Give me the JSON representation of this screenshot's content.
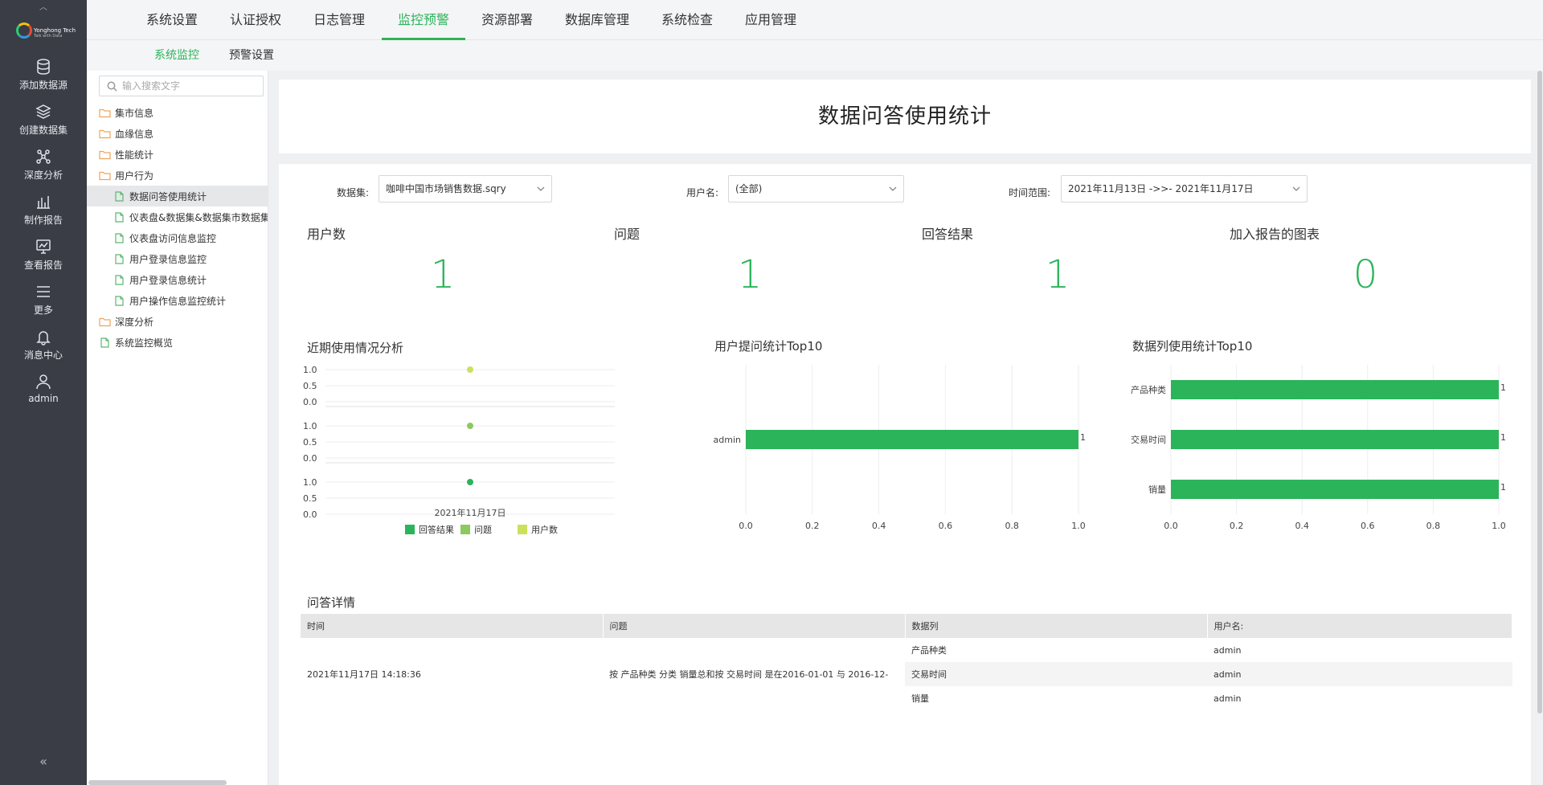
{
  "rail": {
    "brand": "Yonghong Tech",
    "tagline": "Talk with Data",
    "items": [
      {
        "label": "添加数据源",
        "icon": "database-icon"
      },
      {
        "label": "创建数据集",
        "icon": "layers-icon"
      },
      {
        "label": "深度分析",
        "icon": "network-icon"
      },
      {
        "label": "制作报告",
        "icon": "bar-chart-icon"
      },
      {
        "label": "查看报告",
        "icon": "monitor-chart-icon"
      },
      {
        "label": "更多",
        "icon": "menu-icon"
      },
      {
        "label": "消息中心",
        "icon": "bell-icon"
      },
      {
        "label": "admin",
        "icon": "user-icon"
      }
    ],
    "collapse_glyph": "«"
  },
  "topnav": {
    "items": [
      "系统设置",
      "认证授权",
      "日志管理",
      "监控预警",
      "资源部署",
      "数据库管理",
      "系统检查",
      "应用管理"
    ],
    "active": "监控预警"
  },
  "subnav": {
    "items": [
      "系统监控",
      "预警设置"
    ],
    "active": "系统监控"
  },
  "tree": {
    "search_placeholder": "输入搜索文字",
    "nodes": [
      {
        "label": "集市信息",
        "type": "folder",
        "level": 0
      },
      {
        "label": "血缘信息",
        "type": "folder",
        "level": 0
      },
      {
        "label": "性能统计",
        "type": "folder",
        "level": 0
      },
      {
        "label": "用户行为",
        "type": "folder-open",
        "level": 0
      },
      {
        "label": "数据问答使用统计",
        "type": "file",
        "level": 1,
        "selected": true
      },
      {
        "label": "仪表盘&数据集&数据集市数据集",
        "type": "file",
        "level": 1
      },
      {
        "label": "仪表盘访问信息监控",
        "type": "file",
        "level": 1
      },
      {
        "label": "用户登录信息监控",
        "type": "file",
        "level": 1
      },
      {
        "label": "用户登录信息统计",
        "type": "file",
        "level": 1
      },
      {
        "label": "用户操作信息监控统计",
        "type": "file",
        "level": 1
      },
      {
        "label": "深度分析",
        "type": "folder",
        "level": 0
      },
      {
        "label": "系统监控概览",
        "type": "file",
        "level": 0
      }
    ]
  },
  "page": {
    "title": "数据问答使用统计"
  },
  "filters": {
    "dataset_label": "数据集:",
    "dataset_value": "咖啡中国市场销售数据.sqry",
    "user_label": "用户名:",
    "user_value": "(全部)",
    "time_label": "时间范围:",
    "time_value": "2021年11月13日 ->>- 2021年11月17日"
  },
  "kpis": [
    {
      "label": "用户数",
      "value": "1"
    },
    {
      "label": "问题",
      "value": "1"
    },
    {
      "label": "回答结果",
      "value": "1"
    },
    {
      "label": "加入报告的图表",
      "value": "0"
    }
  ],
  "colors": {
    "accent": "#2bb45a",
    "series_answer": "#2bb45a",
    "series_question": "#8cc95f",
    "series_users": "#cde05b"
  },
  "chart_data": [
    {
      "type": "scatter",
      "title": "近期使用情况分析",
      "categories": [
        "2021年11月17日"
      ],
      "ylim": [
        0,
        1
      ],
      "yticks": [
        "1.0",
        "0.5",
        "0.0"
      ],
      "series": [
        {
          "name": "用户数",
          "values": [
            1
          ],
          "color": "#cde05b"
        },
        {
          "name": "问题",
          "values": [
            1
          ],
          "color": "#8cc95f"
        },
        {
          "name": "回答结果",
          "values": [
            1
          ],
          "color": "#2bb45a"
        }
      ],
      "legend": [
        "回答结果",
        "问题",
        "用户数"
      ],
      "legend_position": "bottom"
    },
    {
      "type": "bar",
      "orientation": "horizontal",
      "title": "用户提问统计Top10",
      "categories": [
        "admin"
      ],
      "values": [
        1
      ],
      "xlim": [
        0,
        1
      ],
      "xticks": [
        "0.0",
        "0.2",
        "0.4",
        "0.6",
        "0.8",
        "1.0"
      ]
    },
    {
      "type": "bar",
      "orientation": "horizontal",
      "title": "数据列使用统计Top10",
      "categories": [
        "产品种类",
        "交易时间",
        "销量"
      ],
      "values": [
        1,
        1,
        1
      ],
      "xlim": [
        0,
        1
      ],
      "xticks": [
        "0.0",
        "0.2",
        "0.4",
        "0.6",
        "0.8",
        "1.0"
      ]
    }
  ],
  "qa_detail": {
    "title": "问答详情",
    "columns": [
      "时间",
      "问题",
      "数据列",
      "用户名:"
    ],
    "time": "2021年11月17日 14:18:36",
    "question": "按 产品种类 分类 销量总和按 交易时间 是在2016-01-01 与 2016-12-",
    "rows": [
      {
        "column": "产品种类",
        "user": "admin"
      },
      {
        "column": "交易时间",
        "user": "admin"
      },
      {
        "column": "销量",
        "user": "admin"
      }
    ]
  }
}
